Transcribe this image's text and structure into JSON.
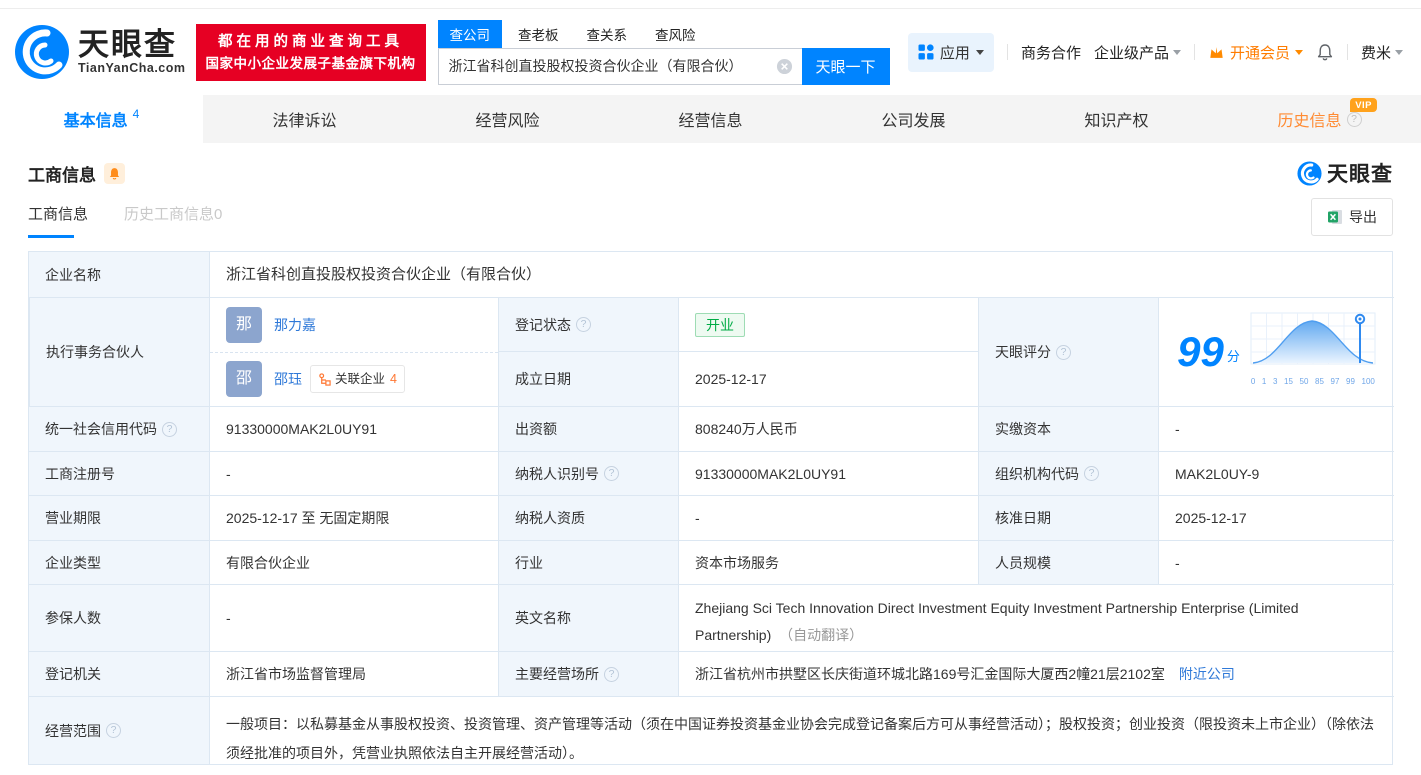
{
  "brand": {
    "name": "天眼查",
    "domain": "TianYanCha.com"
  },
  "topbar": {
    "slogan_line1": "都在用的商业查询工具",
    "slogan_line2": "国家中小企业发展子基金旗下机构",
    "search_tabs": [
      {
        "label": "查公司"
      },
      {
        "label": "查老板"
      },
      {
        "label": "查关系"
      },
      {
        "label": "查风险"
      }
    ],
    "search_value": "浙江省科创直投股权投资合伙企业（有限合伙）",
    "search_button": "天眼一下",
    "menu_apps": "应用",
    "menu_cooperation": "商务合作",
    "menu_enterprise": "企业级产品",
    "menu_vip": "开通会员",
    "menu_user": "费米"
  },
  "nav_tabs": [
    {
      "label": "基本信息",
      "count": "4"
    },
    {
      "label": "法律诉讼"
    },
    {
      "label": "经营风险"
    },
    {
      "label": "经营信息"
    },
    {
      "label": "公司发展"
    },
    {
      "label": "知识产权"
    },
    {
      "label": "历史信息",
      "vip": "VIP"
    }
  ],
  "section": {
    "title": "工商信息",
    "watermark": "天眼查"
  },
  "card": {
    "tab_current": "工商信息",
    "tab_history": "历史工商信息0",
    "export": "导出"
  },
  "info": {
    "company_name": {
      "label": "企业名称",
      "value": "浙江省科创直投股权投资合伙企业（有限合伙）"
    },
    "partners": {
      "label": "执行事务合伙人",
      "list": [
        {
          "avatar": "那",
          "name": "那力嘉"
        },
        {
          "avatar": "邵",
          "name": "邵珏",
          "related_label": "关联企业",
          "related_count": "4"
        }
      ]
    },
    "reg_status": {
      "label": "登记状态",
      "value": "开业"
    },
    "establish_date": {
      "label": "成立日期",
      "value": "2025-12-17"
    },
    "score": {
      "label": "天眼评分",
      "value": "99",
      "unit": "分",
      "axis": [
        "0",
        "1",
        "3",
        "15",
        "50",
        "85",
        "97",
        "99",
        "100"
      ]
    },
    "credit_code": {
      "label": "统一社会信用代码",
      "value": "91330000MAK2L0UY91"
    },
    "contribution": {
      "label": "出资额",
      "value": "808240万人民币"
    },
    "paid_capital": {
      "label": "实缴资本",
      "value": "-"
    },
    "reg_number": {
      "label": "工商注册号",
      "value": "-"
    },
    "taxpayer_id": {
      "label": "纳税人识别号",
      "value": "91330000MAK2L0UY91"
    },
    "org_code": {
      "label": "组织机构代码",
      "value": "MAK2L0UY-9"
    },
    "business_term": {
      "label": "营业期限",
      "value": "2025-12-17 至 无固定期限"
    },
    "taxpayer_quality": {
      "label": "纳税人资质",
      "value": "-"
    },
    "approval_date": {
      "label": "核准日期",
      "value": "2025-12-17"
    },
    "company_type": {
      "label": "企业类型",
      "value": "有限合伙企业"
    },
    "industry": {
      "label": "行业",
      "value": "资本市场服务"
    },
    "staff_size": {
      "label": "人员规模",
      "value": "-"
    },
    "insured_count": {
      "label": "参保人数",
      "value": "-"
    },
    "english_name": {
      "label": "英文名称",
      "value": "Zhejiang Sci Tech Innovation Direct Investment Equity Investment Partnership Enterprise (Limited Partnership)",
      "note": "（自动翻译）"
    },
    "registry": {
      "label": "登记机关",
      "value": "浙江省市场监督管理局"
    },
    "address": {
      "label": "主要经营场所",
      "value": "浙江省杭州市拱墅区长庆街道环城北路169号汇金国际大厦西2幢21层2102室",
      "link": "附近公司"
    },
    "business_scope": {
      "label": "经营范围",
      "value": "一般项目：以私募基金从事股权投资、投资管理、资产管理等活动（须在中国证券投资基金业协会完成登记备案后方可从事经营活动）；股权投资；创业投资（限投资未上市企业）（除依法须经批准的项目外，凭营业执照依法自主开展经营活动）。"
    }
  },
  "icons": {
    "help": "?"
  },
  "colors": {
    "accent": "#0084ff",
    "orange": "#ff7c00",
    "red": "#e60023",
    "green": "#00ab45",
    "link": "#2f79d8"
  }
}
